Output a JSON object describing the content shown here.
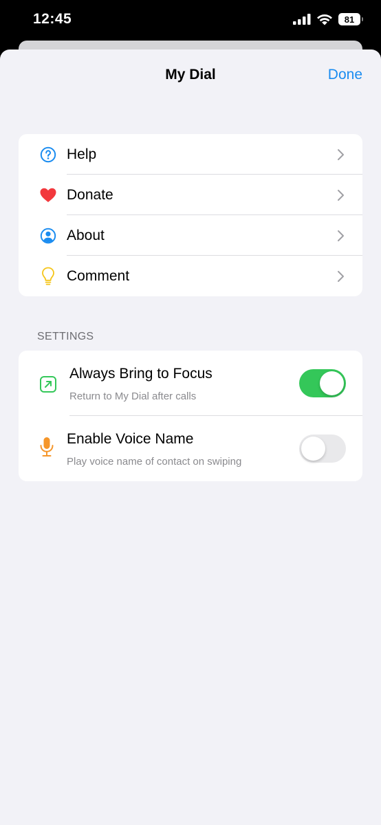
{
  "status_bar": {
    "time": "12:45",
    "battery": "81"
  },
  "nav": {
    "title": "My Dial",
    "done_label": "Done"
  },
  "menu": {
    "items": [
      {
        "label": "Help",
        "icon": "question-circle-icon",
        "color": "#1a8cf0"
      },
      {
        "label": "Donate",
        "icon": "heart-icon",
        "color": "#f2383d"
      },
      {
        "label": "About",
        "icon": "person-circle-icon",
        "color": "#1a8cf0"
      },
      {
        "label": "Comment",
        "icon": "lightbulb-icon",
        "color": "#f5c518"
      }
    ]
  },
  "settings": {
    "header": "SETTINGS",
    "items": [
      {
        "title": "Always Bring to Focus",
        "subtitle": "Return to My Dial after calls",
        "icon": "arrow-up-right-square-icon",
        "color": "#34c759",
        "enabled": true
      },
      {
        "title": "Enable Voice Name",
        "subtitle": "Play voice name of contact on swiping",
        "icon": "microphone-icon",
        "color": "#f5962a",
        "enabled": false
      }
    ]
  },
  "colors": {
    "accent": "#1a8cf0",
    "toggle_on": "#34c759",
    "toggle_off": "#e9e9eb",
    "background": "#f2f2f7"
  }
}
